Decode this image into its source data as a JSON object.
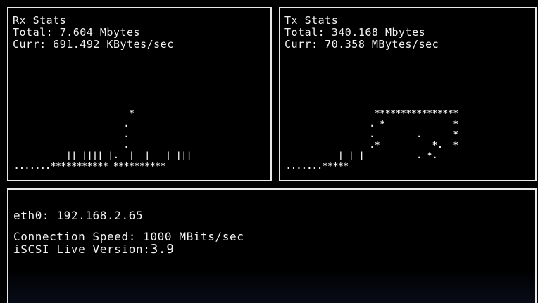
{
  "rx": {
    "title": "Rx Stats",
    "total": "Total: 7.604 Mbytes",
    "current": "Curr: 691.492 KBytes/sec",
    "graph_lines": [
      "                      *        ",
      "                     .         ",
      "                     .         ",
      "                     .         ",
      "          || |||| |.  |  |   | |||",
      ".......*********** **********"
    ]
  },
  "tx": {
    "title": "Tx Stats",
    "total": "Total: 340.168 Mbytes",
    "current": "Curr: 70.358 MBytes/sec",
    "graph_lines": [
      "                 ****************",
      "                . *             *",
      "                .        .      *",
      "                .*          *.  *",
      "          | | |          . *.  ",
      ".......*****                  "
    ]
  },
  "net": {
    "interface": "eth0: 192.168.2.65",
    "connection_speed": "Connection Speed: 1000 MBits/sec",
    "version_label": "iSCSI Live Version:",
    "version_value": "3.9"
  }
}
